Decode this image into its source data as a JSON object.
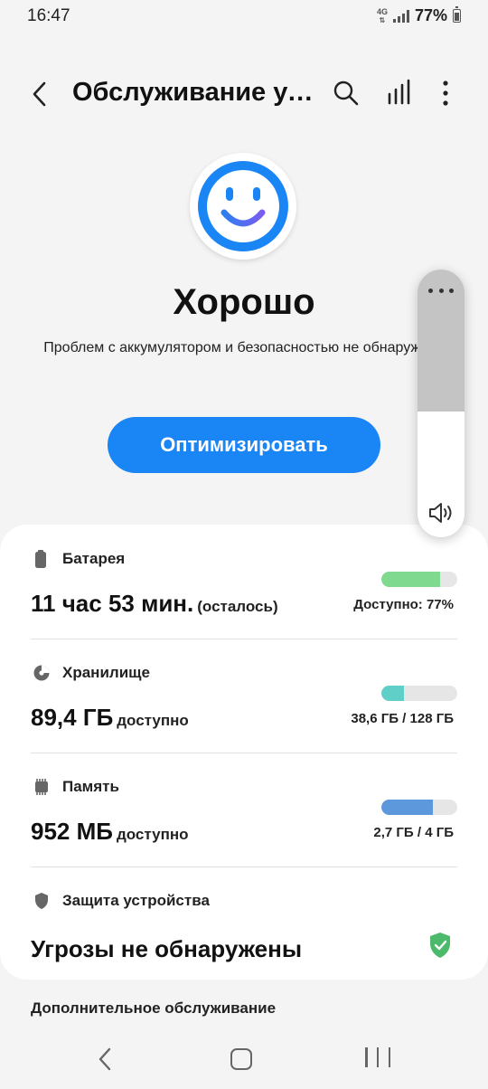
{
  "status_bar": {
    "time": "16:47",
    "network_type": "4G",
    "battery_percent": "77%"
  },
  "header": {
    "title": "Обслуживание устройства",
    "back_icon": "chevron-left-icon",
    "search_icon": "search-icon",
    "stats_icon": "bar-chart-icon",
    "more_icon": "more-vertical-icon"
  },
  "summary": {
    "status": "Хорошо",
    "description": "Проблем с аккумулятором и безопасностью не обнаружено",
    "optimize_label": "Оптимизировать"
  },
  "volume_panel": {
    "level": 0.47,
    "more_icon": "more-horizontal-icon",
    "speaker_icon": "speaker-icon"
  },
  "items": {
    "battery": {
      "title": "Батарея",
      "value": "11 час 53 мин.",
      "unit": "(осталось)",
      "right": "Доступно: 77%",
      "fill": 0.77,
      "color": "#7fd98f"
    },
    "storage": {
      "title": "Хранилище",
      "value": "89,4 ГБ",
      "unit": "доступно",
      "right": "38,6 ГБ / 128 ГБ",
      "fill": 0.3,
      "color": "#5fcfc8"
    },
    "memory": {
      "title": "Память",
      "value": "952 МБ",
      "unit": "доступно",
      "right": "2,7 ГБ / 4 ГБ",
      "fill": 0.675,
      "color": "#5d98dc"
    },
    "protection": {
      "title": "Защита устройства",
      "value": "Угрозы не обнаружены",
      "ok_color": "#4cb96b"
    }
  },
  "extra": {
    "title": "Дополнительное обслуживание"
  },
  "colors": {
    "accent": "#1a86f5",
    "background": "#f4f4f4"
  }
}
